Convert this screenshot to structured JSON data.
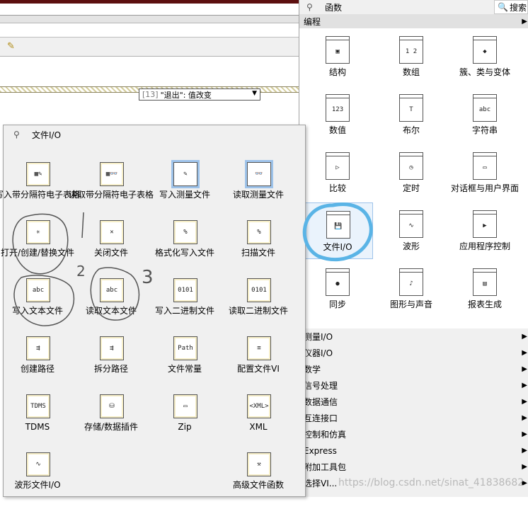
{
  "block_diagram": {
    "case_selector": {
      "index": "[13]",
      "text": "\"退出\": 值改变"
    }
  },
  "sub_palette": {
    "title": "文件I/O",
    "items": [
      {
        "label": "写入带分隔符电子表格",
        "icon": "spreadsheet-write-icon",
        "glyph": "▦✎"
      },
      {
        "label": "读取带分隔符电子表格",
        "icon": "spreadsheet-read-icon",
        "glyph": "▦👓"
      },
      {
        "label": "写入测量文件",
        "icon": "measurement-write-icon",
        "glyph": "✎"
      },
      {
        "label": "读取测量文件",
        "icon": "measurement-read-icon",
        "glyph": "👓"
      },
      {
        "label": "打开/创建/替换文件",
        "icon": "open-file-icon",
        "glyph": "✳"
      },
      {
        "label": "关闭文件",
        "icon": "close-file-icon",
        "glyph": "✕"
      },
      {
        "label": "格式化写入文件",
        "icon": "format-write-icon",
        "glyph": "%"
      },
      {
        "label": "扫描文件",
        "icon": "scan-file-icon",
        "glyph": "%"
      },
      {
        "label": "写入文本文件",
        "icon": "write-text-icon",
        "glyph": "abc"
      },
      {
        "label": "读取文本文件",
        "icon": "read-text-icon",
        "glyph": "abc"
      },
      {
        "label": "写入二进制文件",
        "icon": "write-binary-icon",
        "glyph": "0101"
      },
      {
        "label": "读取二进制文件",
        "icon": "read-binary-icon",
        "glyph": "0101"
      },
      {
        "label": "创建路径",
        "icon": "build-path-icon",
        "glyph": "⇶"
      },
      {
        "label": "拆分路径",
        "icon": "strip-path-icon",
        "glyph": "⇶"
      },
      {
        "label": "文件常量",
        "icon": "file-constant-icon",
        "glyph": "Path"
      },
      {
        "label": "配置文件VI",
        "icon": "config-file-icon",
        "glyph": "≡"
      },
      {
        "label": "TDMS",
        "icon": "tdms-icon",
        "glyph": "TDMS"
      },
      {
        "label": "存储/数据插件",
        "icon": "storage-plugin-icon",
        "glyph": "⛁"
      },
      {
        "label": "Zip",
        "icon": "zip-icon",
        "glyph": "▭"
      },
      {
        "label": "XML",
        "icon": "xml-icon",
        "glyph": "<XML>"
      },
      {
        "label": "波形文件I/O",
        "icon": "waveform-file-icon",
        "glyph": "∿"
      },
      {
        "label": "",
        "icon": "empty-slot",
        "glyph": ""
      },
      {
        "label": "",
        "icon": "empty-slot",
        "glyph": ""
      },
      {
        "label": "高级文件函数",
        "icon": "advanced-file-icon",
        "glyph": "⚒"
      }
    ],
    "annotations": [
      "2",
      "3"
    ]
  },
  "main_palette": {
    "title": "函数",
    "search_label": "搜索",
    "category": "编程",
    "items": [
      {
        "label": "结构",
        "icon": "structures-icon",
        "glyph": "▣"
      },
      {
        "label": "数组",
        "icon": "array-icon",
        "glyph": "1 2"
      },
      {
        "label": "簇、类与变体",
        "icon": "cluster-icon",
        "glyph": "◆"
      },
      {
        "label": "数值",
        "icon": "numeric-icon",
        "glyph": "123"
      },
      {
        "label": "布尔",
        "icon": "boolean-icon",
        "glyph": "T"
      },
      {
        "label": "字符串",
        "icon": "string-icon",
        "glyph": "abc"
      },
      {
        "label": "比较",
        "icon": "comparison-icon",
        "glyph": "▷"
      },
      {
        "label": "定时",
        "icon": "timing-icon",
        "glyph": "◷"
      },
      {
        "label": "对话框与用户界面",
        "icon": "dialog-icon",
        "glyph": "▭"
      },
      {
        "label": "文件I/O",
        "icon": "file-io-icon",
        "glyph": "💾"
      },
      {
        "label": "波形",
        "icon": "waveform-icon",
        "glyph": "∿"
      },
      {
        "label": "应用程序控制",
        "icon": "app-control-icon",
        "glyph": "▶"
      },
      {
        "label": "同步",
        "icon": "sync-icon",
        "glyph": "●"
      },
      {
        "label": "图形与声音",
        "icon": "graphics-icon",
        "glyph": "♪"
      },
      {
        "label": "报表生成",
        "icon": "report-icon",
        "glyph": "▤"
      }
    ],
    "list": [
      "测量I/O",
      "仪器I/O",
      "数学",
      "信号处理",
      "数据通信",
      "互连接口",
      "控制和仿真",
      "Express",
      "附加工具包",
      "选择VI..."
    ]
  },
  "watermark": "https://blog.csdn.net/sinat_41838682",
  "colors": {
    "selection": "#9ec3ea",
    "annotation": "#5ab4e6"
  }
}
